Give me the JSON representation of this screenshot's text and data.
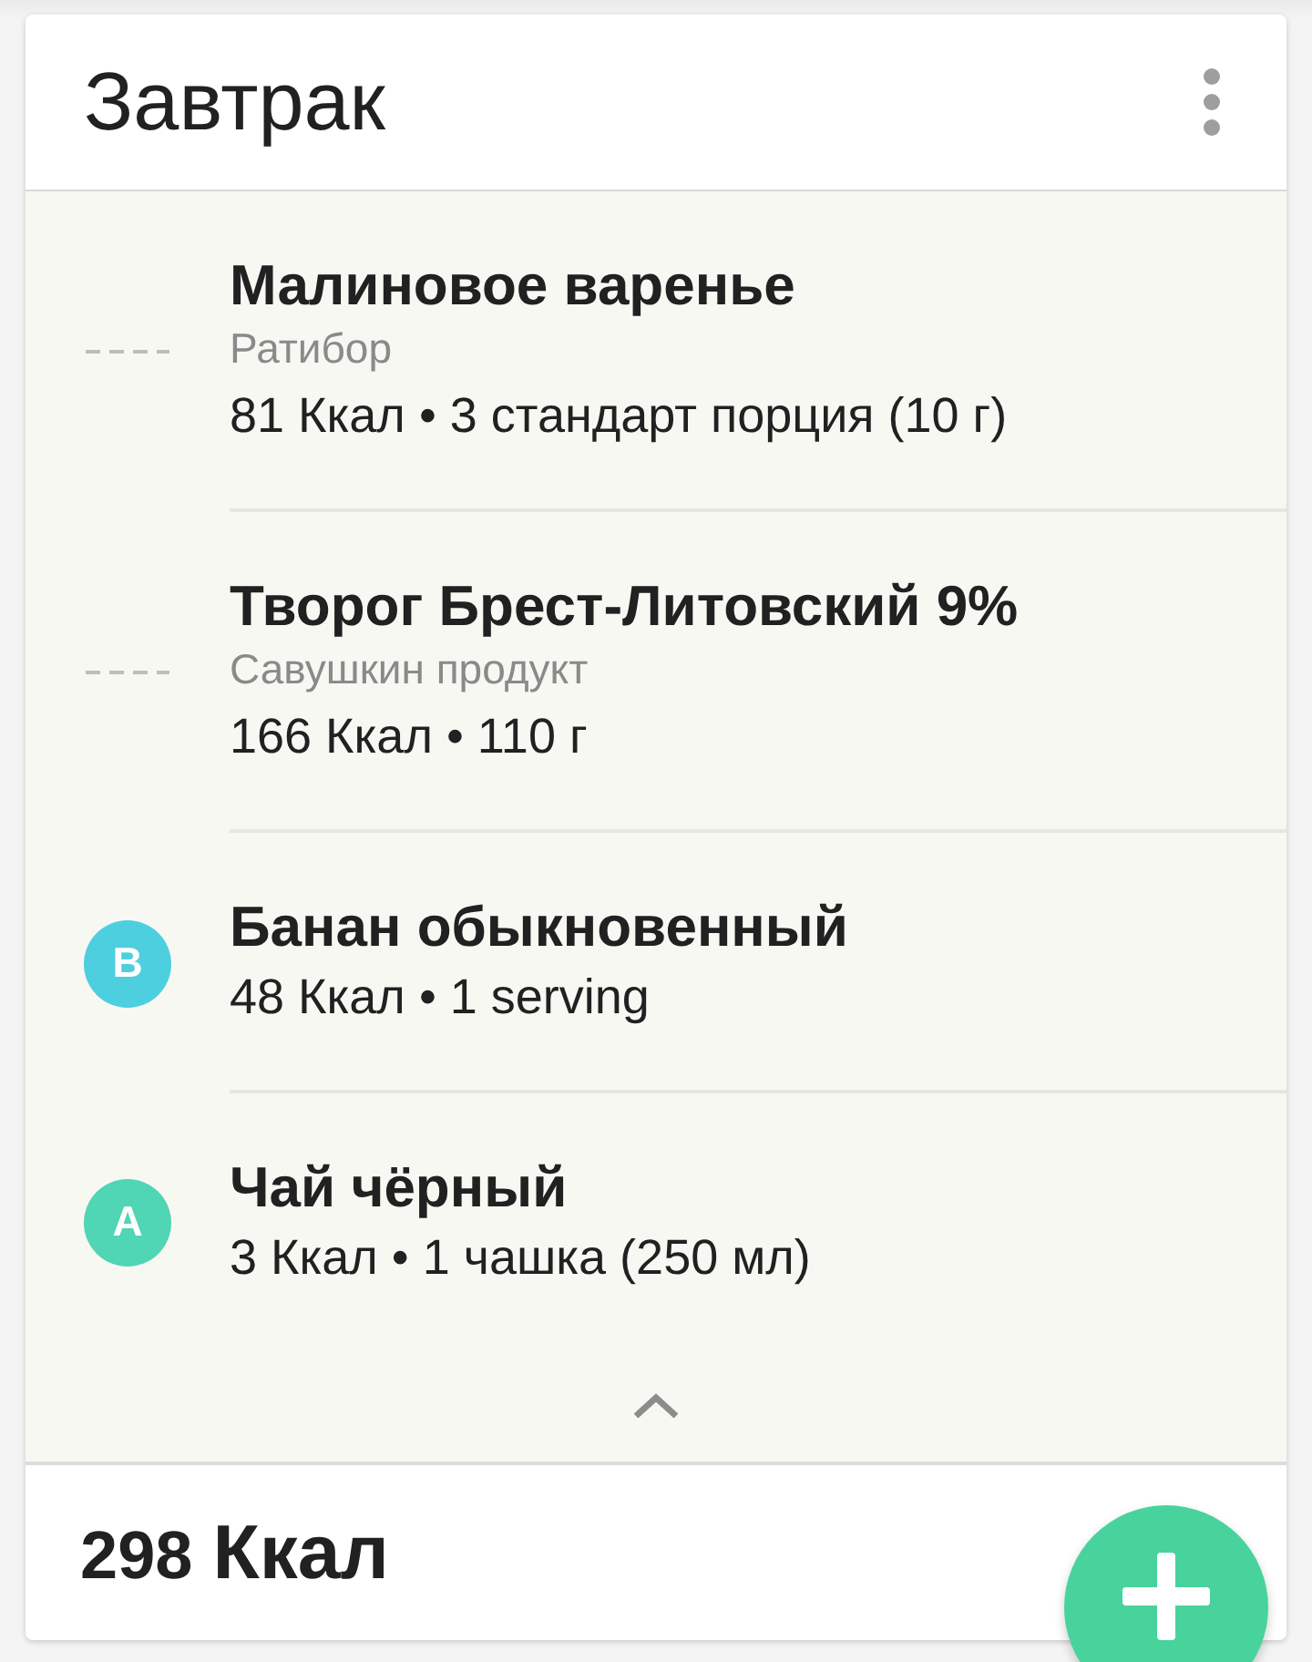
{
  "card": {
    "title": "Завтрак",
    "items": [
      {
        "name": "Малиновое варенье",
        "brand": "Ратибор",
        "details": "81 Ккал • 3 стандарт порция (10 г)",
        "grade": {
          "kind": "none"
        }
      },
      {
        "name": "Творог Брест-Литовский 9%",
        "brand": "Савушкин продукт",
        "details": "166 Ккал • 110 г",
        "grade": {
          "kind": "none"
        }
      },
      {
        "name": "Банан обыкновенный",
        "details": "48 Ккал • 1 serving",
        "grade": {
          "kind": "letter",
          "letter": "B",
          "color": "#4dcfe0"
        }
      },
      {
        "name": "Чай чёрный",
        "details": "3 Ккал • 1 чашка (250 мл)",
        "grade": {
          "kind": "letter",
          "letter": "A",
          "color": "#50d5b5"
        }
      }
    ],
    "expanded": true,
    "total": {
      "value": "298",
      "unit": "Ккал"
    }
  }
}
